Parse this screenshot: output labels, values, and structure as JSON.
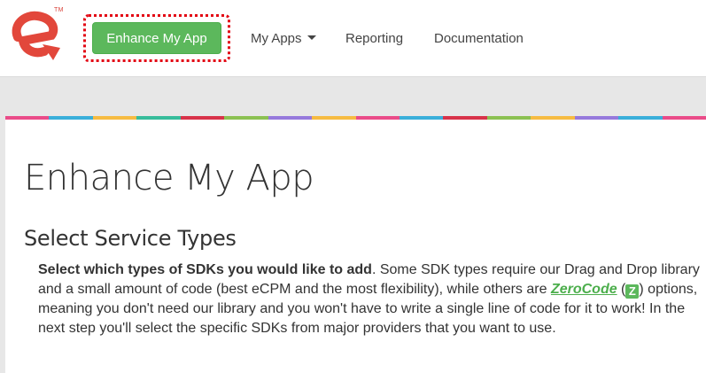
{
  "brand": {
    "trademark": "TM",
    "colors": {
      "logo_red": "#e2473b",
      "cta_green": "#5cb85c",
      "cta_outline_red": "#e30613"
    }
  },
  "nav": {
    "cta_label": "Enhance My App",
    "items": [
      {
        "label": "My Apps",
        "has_dropdown": true
      },
      {
        "label": "Reporting"
      },
      {
        "label": "Documentation"
      }
    ]
  },
  "stripe_colors": [
    "#ea4c89",
    "#3bafda",
    "#f6bb42",
    "#37bc9b",
    "#d8334a",
    "#8cc152",
    "#967adc",
    "#f6bb42",
    "#ea4c89",
    "#3bafda",
    "#d8334a",
    "#8cc152",
    "#f6bb42",
    "#967adc",
    "#3bafda",
    "#ea4c89"
  ],
  "main": {
    "page_title": "Enhance My App",
    "section_title": "Select Service Types",
    "description": {
      "lead_bold": "Select which types of SDKs you would like to add",
      "part1": ". Some SDK types require our Drag and Drop library and a small amount of code (best eCPM and the most flexibility), while others are ",
      "zerocode_link": "ZeroCode",
      "open_paren": " (",
      "badge_letter": "Z",
      "part2": ") options, meaning you don't need our library and you won't have to write a single line of code for it to work! In the next step you'll select the specific SDKs from major providers that you want to use."
    }
  }
}
